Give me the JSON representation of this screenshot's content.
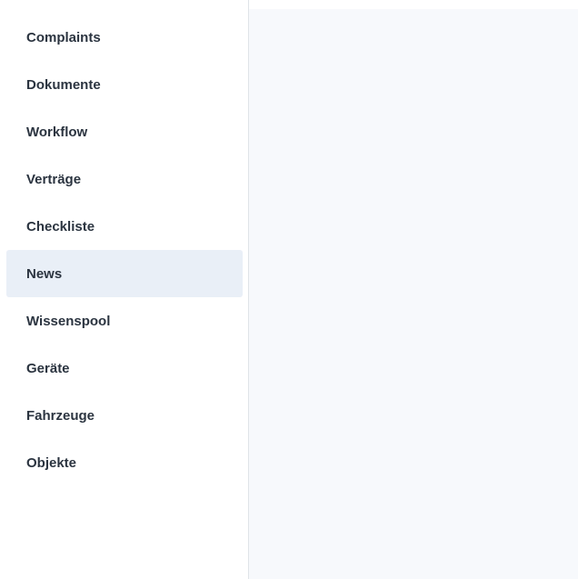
{
  "sidebar": {
    "items": [
      {
        "label": "Complaints",
        "active": false
      },
      {
        "label": "Dokumente",
        "active": false
      },
      {
        "label": "Workflow",
        "active": false
      },
      {
        "label": "Verträge",
        "active": false
      },
      {
        "label": "Checkliste",
        "active": false
      },
      {
        "label": "News",
        "active": true
      },
      {
        "label": "Wissenspool",
        "active": false
      },
      {
        "label": "Geräte",
        "active": false
      },
      {
        "label": "Fahrzeuge",
        "active": false
      },
      {
        "label": "Objekte",
        "active": false
      }
    ]
  },
  "colors": {
    "active_background": "#e9eff7",
    "text": "#2b3440",
    "content_background": "#f7f9fc",
    "divider": "#dfe3e8"
  }
}
